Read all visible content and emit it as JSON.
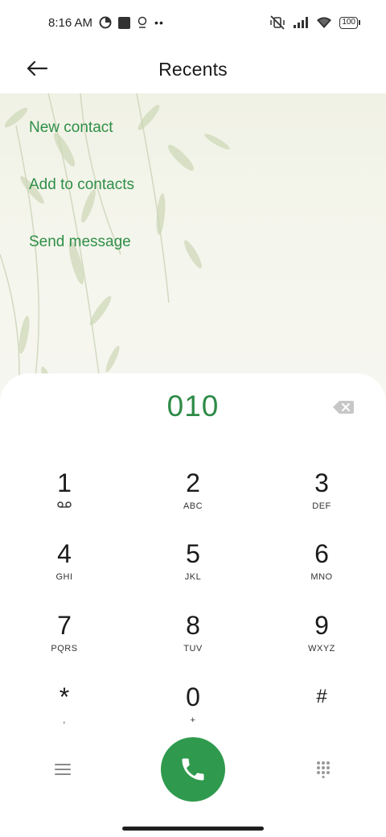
{
  "status_bar": {
    "time": "8:16 AM",
    "battery": "100",
    "icons": [
      "clock-icon",
      "square-icon",
      "location-icon",
      "more-dots-icon",
      "vibrate-mute-icon",
      "signal-icon",
      "wifi-icon",
      "battery-icon"
    ]
  },
  "header": {
    "title": "Recents",
    "back_icon": "back-arrow-icon"
  },
  "actions": [
    {
      "label": "New contact"
    },
    {
      "label": "Add to contacts"
    },
    {
      "label": "Send message"
    }
  ],
  "dialer": {
    "number": "010",
    "backspace_icon": "backspace-icon",
    "keys": [
      {
        "digit": "1",
        "letters": "",
        "icon": "voicemail-icon"
      },
      {
        "digit": "2",
        "letters": "ABC"
      },
      {
        "digit": "3",
        "letters": "DEF"
      },
      {
        "digit": "4",
        "letters": "GHI"
      },
      {
        "digit": "5",
        "letters": "JKL"
      },
      {
        "digit": "6",
        "letters": "MNO"
      },
      {
        "digit": "7",
        "letters": "PQRS"
      },
      {
        "digit": "8",
        "letters": "TUV"
      },
      {
        "digit": "9",
        "letters": "WXYZ"
      },
      {
        "digit": "*",
        "letters": ","
      },
      {
        "digit": "0",
        "letters": "+"
      },
      {
        "digit": "#",
        "letters": ""
      }
    ]
  },
  "bottom_bar": {
    "menu_icon": "hamburger-menu-icon",
    "call_icon": "phone-icon",
    "keypad_icon": "dialpad-icon"
  },
  "colors": {
    "accent": "#2f8f47",
    "call_button": "#2f9a4d",
    "backdrop": "#f3f4ea"
  }
}
